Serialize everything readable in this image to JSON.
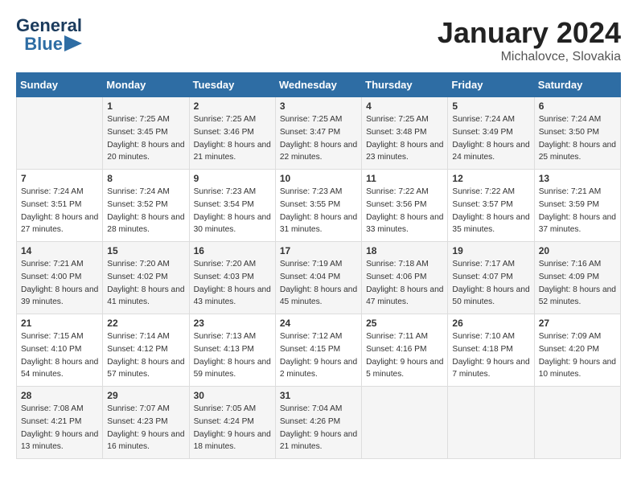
{
  "header": {
    "logo_general": "General",
    "logo_blue": "Blue",
    "month_year": "January 2024",
    "location": "Michalovce, Slovakia"
  },
  "days_of_week": [
    "Sunday",
    "Monday",
    "Tuesday",
    "Wednesday",
    "Thursday",
    "Friday",
    "Saturday"
  ],
  "weeks": [
    [
      {
        "day": "",
        "sunrise": "",
        "sunset": "",
        "daylight": ""
      },
      {
        "day": "1",
        "sunrise": "Sunrise: 7:25 AM",
        "sunset": "Sunset: 3:45 PM",
        "daylight": "Daylight: 8 hours and 20 minutes."
      },
      {
        "day": "2",
        "sunrise": "Sunrise: 7:25 AM",
        "sunset": "Sunset: 3:46 PM",
        "daylight": "Daylight: 8 hours and 21 minutes."
      },
      {
        "day": "3",
        "sunrise": "Sunrise: 7:25 AM",
        "sunset": "Sunset: 3:47 PM",
        "daylight": "Daylight: 8 hours and 22 minutes."
      },
      {
        "day": "4",
        "sunrise": "Sunrise: 7:25 AM",
        "sunset": "Sunset: 3:48 PM",
        "daylight": "Daylight: 8 hours and 23 minutes."
      },
      {
        "day": "5",
        "sunrise": "Sunrise: 7:24 AM",
        "sunset": "Sunset: 3:49 PM",
        "daylight": "Daylight: 8 hours and 24 minutes."
      },
      {
        "day": "6",
        "sunrise": "Sunrise: 7:24 AM",
        "sunset": "Sunset: 3:50 PM",
        "daylight": "Daylight: 8 hours and 25 minutes."
      }
    ],
    [
      {
        "day": "7",
        "sunrise": "Sunrise: 7:24 AM",
        "sunset": "Sunset: 3:51 PM",
        "daylight": "Daylight: 8 hours and 27 minutes."
      },
      {
        "day": "8",
        "sunrise": "Sunrise: 7:24 AM",
        "sunset": "Sunset: 3:52 PM",
        "daylight": "Daylight: 8 hours and 28 minutes."
      },
      {
        "day": "9",
        "sunrise": "Sunrise: 7:23 AM",
        "sunset": "Sunset: 3:54 PM",
        "daylight": "Daylight: 8 hours and 30 minutes."
      },
      {
        "day": "10",
        "sunrise": "Sunrise: 7:23 AM",
        "sunset": "Sunset: 3:55 PM",
        "daylight": "Daylight: 8 hours and 31 minutes."
      },
      {
        "day": "11",
        "sunrise": "Sunrise: 7:22 AM",
        "sunset": "Sunset: 3:56 PM",
        "daylight": "Daylight: 8 hours and 33 minutes."
      },
      {
        "day": "12",
        "sunrise": "Sunrise: 7:22 AM",
        "sunset": "Sunset: 3:57 PM",
        "daylight": "Daylight: 8 hours and 35 minutes."
      },
      {
        "day": "13",
        "sunrise": "Sunrise: 7:21 AM",
        "sunset": "Sunset: 3:59 PM",
        "daylight": "Daylight: 8 hours and 37 minutes."
      }
    ],
    [
      {
        "day": "14",
        "sunrise": "Sunrise: 7:21 AM",
        "sunset": "Sunset: 4:00 PM",
        "daylight": "Daylight: 8 hours and 39 minutes."
      },
      {
        "day": "15",
        "sunrise": "Sunrise: 7:20 AM",
        "sunset": "Sunset: 4:02 PM",
        "daylight": "Daylight: 8 hours and 41 minutes."
      },
      {
        "day": "16",
        "sunrise": "Sunrise: 7:20 AM",
        "sunset": "Sunset: 4:03 PM",
        "daylight": "Daylight: 8 hours and 43 minutes."
      },
      {
        "day": "17",
        "sunrise": "Sunrise: 7:19 AM",
        "sunset": "Sunset: 4:04 PM",
        "daylight": "Daylight: 8 hours and 45 minutes."
      },
      {
        "day": "18",
        "sunrise": "Sunrise: 7:18 AM",
        "sunset": "Sunset: 4:06 PM",
        "daylight": "Daylight: 8 hours and 47 minutes."
      },
      {
        "day": "19",
        "sunrise": "Sunrise: 7:17 AM",
        "sunset": "Sunset: 4:07 PM",
        "daylight": "Daylight: 8 hours and 50 minutes."
      },
      {
        "day": "20",
        "sunrise": "Sunrise: 7:16 AM",
        "sunset": "Sunset: 4:09 PM",
        "daylight": "Daylight: 8 hours and 52 minutes."
      }
    ],
    [
      {
        "day": "21",
        "sunrise": "Sunrise: 7:15 AM",
        "sunset": "Sunset: 4:10 PM",
        "daylight": "Daylight: 8 hours and 54 minutes."
      },
      {
        "day": "22",
        "sunrise": "Sunrise: 7:14 AM",
        "sunset": "Sunset: 4:12 PM",
        "daylight": "Daylight: 8 hours and 57 minutes."
      },
      {
        "day": "23",
        "sunrise": "Sunrise: 7:13 AM",
        "sunset": "Sunset: 4:13 PM",
        "daylight": "Daylight: 8 hours and 59 minutes."
      },
      {
        "day": "24",
        "sunrise": "Sunrise: 7:12 AM",
        "sunset": "Sunset: 4:15 PM",
        "daylight": "Daylight: 9 hours and 2 minutes."
      },
      {
        "day": "25",
        "sunrise": "Sunrise: 7:11 AM",
        "sunset": "Sunset: 4:16 PM",
        "daylight": "Daylight: 9 hours and 5 minutes."
      },
      {
        "day": "26",
        "sunrise": "Sunrise: 7:10 AM",
        "sunset": "Sunset: 4:18 PM",
        "daylight": "Daylight: 9 hours and 7 minutes."
      },
      {
        "day": "27",
        "sunrise": "Sunrise: 7:09 AM",
        "sunset": "Sunset: 4:20 PM",
        "daylight": "Daylight: 9 hours and 10 minutes."
      }
    ],
    [
      {
        "day": "28",
        "sunrise": "Sunrise: 7:08 AM",
        "sunset": "Sunset: 4:21 PM",
        "daylight": "Daylight: 9 hours and 13 minutes."
      },
      {
        "day": "29",
        "sunrise": "Sunrise: 7:07 AM",
        "sunset": "Sunset: 4:23 PM",
        "daylight": "Daylight: 9 hours and 16 minutes."
      },
      {
        "day": "30",
        "sunrise": "Sunrise: 7:05 AM",
        "sunset": "Sunset: 4:24 PM",
        "daylight": "Daylight: 9 hours and 18 minutes."
      },
      {
        "day": "31",
        "sunrise": "Sunrise: 7:04 AM",
        "sunset": "Sunset: 4:26 PM",
        "daylight": "Daylight: 9 hours and 21 minutes."
      },
      {
        "day": "",
        "sunrise": "",
        "sunset": "",
        "daylight": ""
      },
      {
        "day": "",
        "sunrise": "",
        "sunset": "",
        "daylight": ""
      },
      {
        "day": "",
        "sunrise": "",
        "sunset": "",
        "daylight": ""
      }
    ]
  ]
}
